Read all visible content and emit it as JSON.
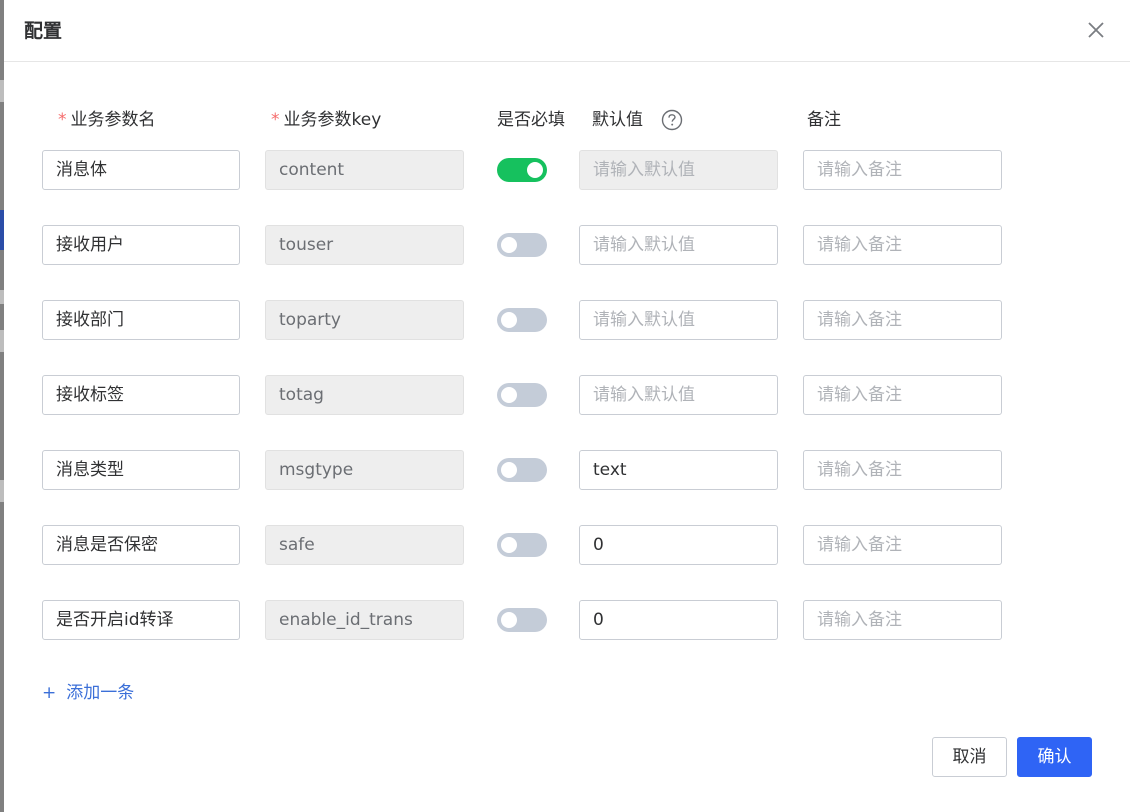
{
  "dialog": {
    "title": "配置"
  },
  "columns": {
    "name": "业务参数名",
    "key": "业务参数key",
    "required": "是否必填",
    "default": "默认值",
    "note": "备注",
    "required_star": "*"
  },
  "rows": [
    {
      "name": "消息体",
      "key": "content",
      "required": true,
      "default_value": "",
      "default_placeholder": "请输入默认值",
      "default_disabled": true,
      "note_placeholder": "请输入备注"
    },
    {
      "name": "接收用户",
      "key": "touser",
      "required": false,
      "default_value": "",
      "default_placeholder": "请输入默认值",
      "default_disabled": false,
      "note_placeholder": "请输入备注"
    },
    {
      "name": "接收部门",
      "key": "toparty",
      "required": false,
      "default_value": "",
      "default_placeholder": "请输入默认值",
      "default_disabled": false,
      "note_placeholder": "请输入备注"
    },
    {
      "name": "接收标签",
      "key": "totag",
      "required": false,
      "default_value": "",
      "default_placeholder": "请输入默认值",
      "default_disabled": false,
      "note_placeholder": "请输入备注"
    },
    {
      "name": "消息类型",
      "key": "msgtype",
      "required": false,
      "default_value": "text",
      "default_placeholder": "请输入默认值",
      "default_disabled": false,
      "note_placeholder": "请输入备注"
    },
    {
      "name": "消息是否保密",
      "key": "safe",
      "required": false,
      "default_value": "0",
      "default_placeholder": "请输入默认值",
      "default_disabled": false,
      "note_placeholder": "请输入备注"
    },
    {
      "name": "是否开启id转译",
      "key": "enable_id_trans",
      "required": false,
      "default_value": "0",
      "default_placeholder": "请输入默认值",
      "default_disabled": false,
      "note_placeholder": "请输入备注"
    }
  ],
  "add_row": {
    "icon": "+",
    "label": "添加一条"
  },
  "footer": {
    "cancel": "取消",
    "confirm": "确认"
  },
  "colors": {
    "accent": "#2f64f5",
    "switch_on": "#16c15e",
    "switch_off": "#c4ccd8",
    "link": "#3b6fd8",
    "required_star": "#f56c6c"
  },
  "icons": {
    "close": "close-icon",
    "help": "help-circle-icon"
  }
}
